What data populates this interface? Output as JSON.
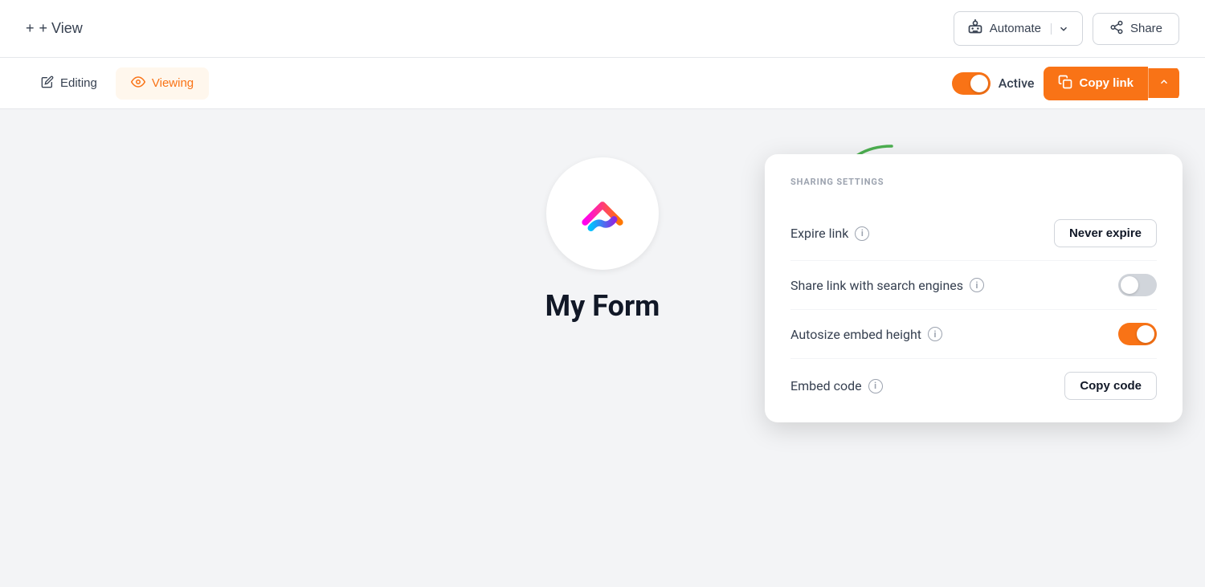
{
  "topbar": {
    "add_view_label": "+ View",
    "automate_label": "Automate",
    "share_label": "Share"
  },
  "view_tabs": {
    "editing_label": "Editing",
    "viewing_label": "Viewing",
    "active_label": "Active",
    "copy_link_label": "Copy link"
  },
  "form": {
    "title": "My Form"
  },
  "sharing_settings": {
    "section_title": "SHARING SETTINGS",
    "expire_link_label": "Expire link",
    "expire_link_value": "Never expire",
    "search_engines_label": "Share link with search engines",
    "autosize_label": "Autosize embed height",
    "embed_code_label": "Embed code",
    "copy_code_label": "Copy code"
  },
  "icons": {
    "plus": "+",
    "pencil": "✏",
    "eye": "👁",
    "robot": "🤖",
    "share": "⬆",
    "copy": "⧉",
    "chevron_down": "∨",
    "chevron_up": "∧",
    "info": "i"
  },
  "colors": {
    "orange": "#f97316",
    "orange_light_bg": "#fff7ed",
    "gray_border": "#d1d5db",
    "text_dark": "#374151",
    "toggle_off": "#d1d5db"
  }
}
